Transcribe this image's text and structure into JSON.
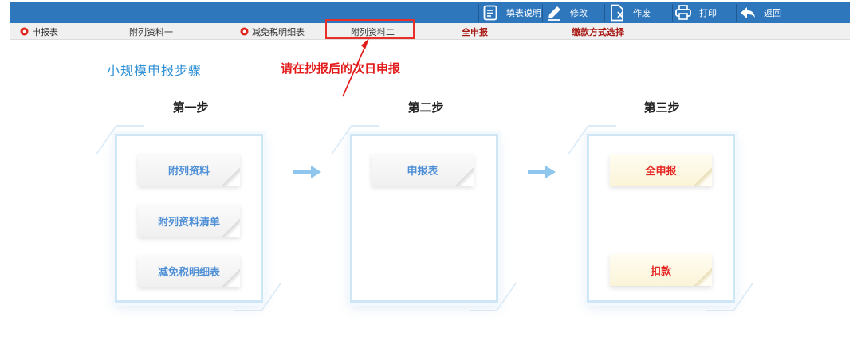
{
  "toolbar": {
    "buttons": [
      {
        "label": "填表说明",
        "icon": "document-lines-icon"
      },
      {
        "label": "修改",
        "icon": "pencil-icon"
      },
      {
        "label": "作废",
        "icon": "document-x-icon"
      },
      {
        "label": "打印",
        "icon": "printer-icon"
      },
      {
        "label": "返回",
        "icon": "back-arrow-icon"
      }
    ]
  },
  "tabs": [
    {
      "label": "申报表",
      "dot": true
    },
    {
      "label": "附列资料一",
      "dot": false
    },
    {
      "label": "减免税明细表",
      "dot": true
    },
    {
      "label": "附列资料二",
      "dot": false
    },
    {
      "label": "全申报",
      "dot": false,
      "bold": true
    },
    {
      "label": "缴款方式选择",
      "dot": false,
      "bold": true
    }
  ],
  "colors": {
    "toolbar_bg": "#2f77bd",
    "tab_dot": "#e1261c",
    "annotation": "#e21a1a",
    "title_blue": "#2d8fd5",
    "card_blue_text": "#4f8fd6",
    "card_red_text": "#e52622"
  },
  "annotation": {
    "text": "请在抄报后的次日申报"
  },
  "page": {
    "title": "小规模申报步骤"
  },
  "steps": [
    {
      "title": "第一步",
      "cards": [
        "附列资料",
        "附列资料清单",
        "减免税明细表"
      ]
    },
    {
      "title": "第二步",
      "cards": [
        "申报表"
      ]
    },
    {
      "title": "第三步",
      "cards": [
        "全申报",
        "扣款"
      ]
    }
  ]
}
